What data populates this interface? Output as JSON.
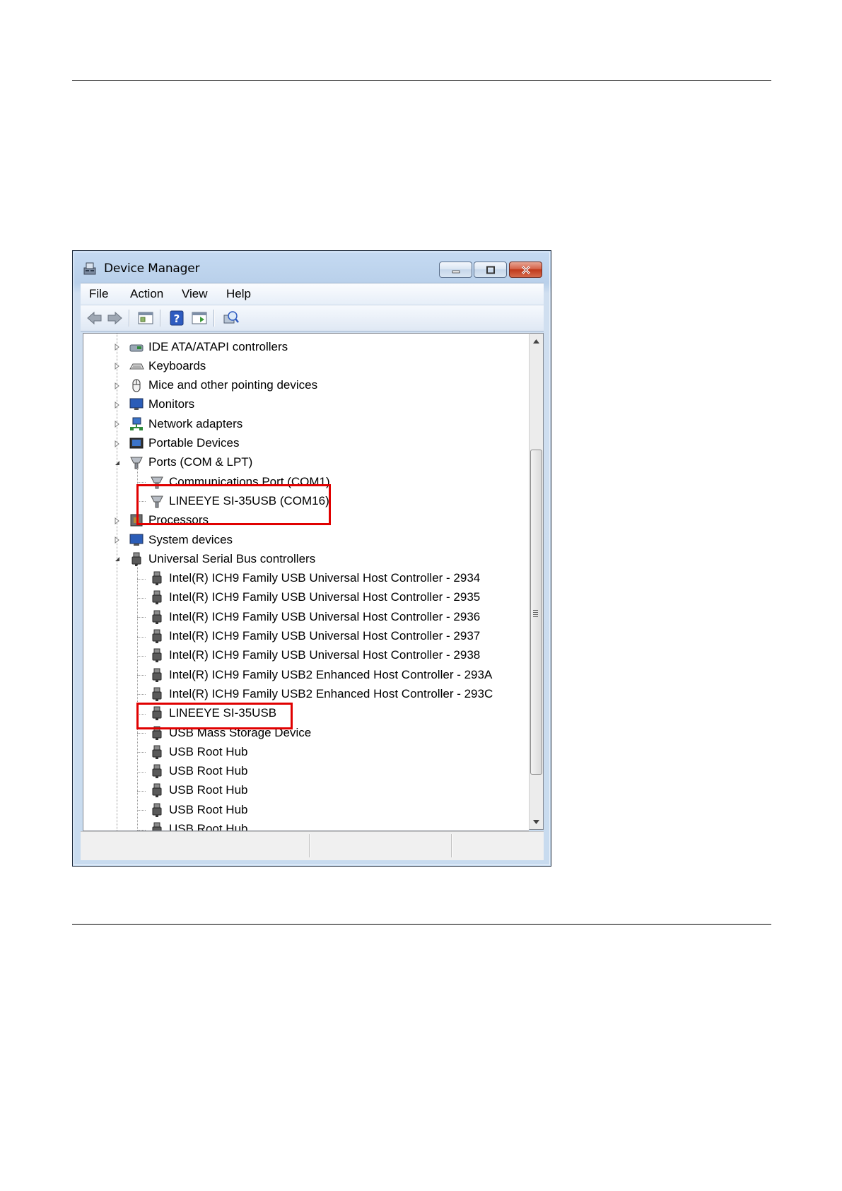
{
  "window": {
    "title": "Device Manager",
    "buttons": {
      "minimize": "minimize",
      "maximize": "maximize",
      "close": "close"
    }
  },
  "menu": [
    "File",
    "Action",
    "View",
    "Help"
  ],
  "toolbar": [
    "back-icon",
    "forward-icon",
    "properties-icon",
    "help-icon",
    "update-driver-icon",
    "scan-hardware-icon"
  ],
  "tree": {
    "categories": [
      {
        "label": "IDE ATA/ATAPI controllers",
        "icon": "ide-controller-icon",
        "expanded": false
      },
      {
        "label": "Keyboards",
        "icon": "keyboard-icon",
        "expanded": false
      },
      {
        "label": "Mice and other pointing devices",
        "icon": "mouse-icon",
        "expanded": false
      },
      {
        "label": "Monitors",
        "icon": "monitor-icon",
        "expanded": false
      },
      {
        "label": "Network adapters",
        "icon": "network-adapter-icon",
        "expanded": false
      },
      {
        "label": "Portable Devices",
        "icon": "portable-device-icon",
        "expanded": false
      },
      {
        "label": "Ports (COM & LPT)",
        "icon": "port-icon",
        "expanded": true,
        "children": [
          "Communications Port (COM1)",
          "LINEEYE SI-35USB (COM16)"
        ]
      },
      {
        "label": "Processors",
        "icon": "processor-icon",
        "expanded": false
      },
      {
        "label": "System devices",
        "icon": "system-device-icon",
        "expanded": false
      },
      {
        "label": "Universal Serial Bus controllers",
        "icon": "usb-icon",
        "expanded": true,
        "children": [
          "Intel(R) ICH9 Family USB Universal Host Controller - 2934",
          "Intel(R) ICH9 Family USB Universal Host Controller - 2935",
          "Intel(R) ICH9 Family USB Universal Host Controller - 2936",
          "Intel(R) ICH9 Family USB Universal Host Controller - 2937",
          "Intel(R) ICH9 Family USB Universal Host Controller - 2938",
          "Intel(R) ICH9 Family USB2 Enhanced Host Controller - 293A",
          "Intel(R) ICH9 Family USB2 Enhanced Host Controller - 293C",
          "LINEEYE SI-35USB",
          "USB Mass Storage Device",
          "USB Root Hub",
          "USB Root Hub",
          "USB Root Hub",
          "USB Root Hub",
          "USB Root Hub"
        ]
      }
    ]
  },
  "highlights": [
    "LINEEYE SI-35USB (COM16)",
    "LINEEYE SI-35USB"
  ],
  "colors": {
    "highlight": "#e00000",
    "titlebar": "#c5daf2",
    "close_button": "#c0391b"
  }
}
